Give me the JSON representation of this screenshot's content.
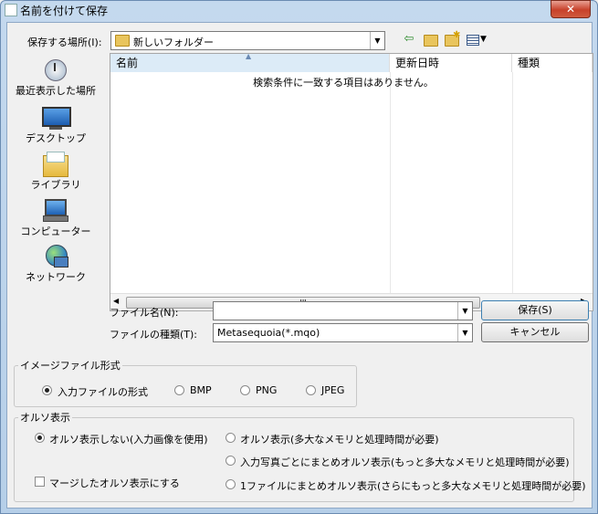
{
  "window": {
    "title": "名前を付けて保存",
    "close_glyph": "✕"
  },
  "location": {
    "label": "保存する場所(I):",
    "folder": "新しいフォルダー"
  },
  "toolbar_icons": [
    "back-arrow-icon",
    "up-folder-icon",
    "new-folder-icon",
    "view-menu-icon"
  ],
  "places": [
    {
      "label": "最近表示した場所",
      "icon": "recent-places-icon"
    },
    {
      "label": "デスクトップ",
      "icon": "desktop-icon"
    },
    {
      "label": "ライブラリ",
      "icon": "libraries-icon"
    },
    {
      "label": "コンピューター",
      "icon": "computer-icon"
    },
    {
      "label": "ネットワーク",
      "icon": "network-icon"
    }
  ],
  "file_list": {
    "columns": [
      "名前",
      "更新日時",
      "種類"
    ],
    "empty_message": "検索条件に一致する項目はありません。",
    "scroll_grip": "III"
  },
  "filename": {
    "label": "ファイル名(N):",
    "value": ""
  },
  "filetype": {
    "label": "ファイルの種類(T):",
    "value": "Metasequoia(*.mqo)"
  },
  "buttons": {
    "save": "保存(S)",
    "cancel": "キャンセル"
  },
  "image_format": {
    "legend": "イメージファイル形式",
    "options": [
      {
        "label": "入力ファイルの形式",
        "selected": true
      },
      {
        "label": "BMP",
        "selected": false
      },
      {
        "label": "PNG",
        "selected": false
      },
      {
        "label": "JPEG",
        "selected": false
      }
    ]
  },
  "ortho": {
    "legend": "オルソ表示",
    "options": [
      {
        "label": "オルソ表示しない(入力画像を使用)",
        "selected": true
      },
      {
        "label": "オルソ表示(多大なメモリと処理時間が必要)",
        "selected": false
      },
      {
        "label": "入力写真ごとにまとめオルソ表示(もっと多大なメモリと処理時間が必要)",
        "selected": false
      },
      {
        "label": "1ファイルにまとめオルソ表示(さらにもっと多大なメモリと処理時間が必要)",
        "selected": false
      }
    ],
    "merge_checkbox": {
      "label": "マージしたオルソ表示にする",
      "checked": false
    }
  }
}
